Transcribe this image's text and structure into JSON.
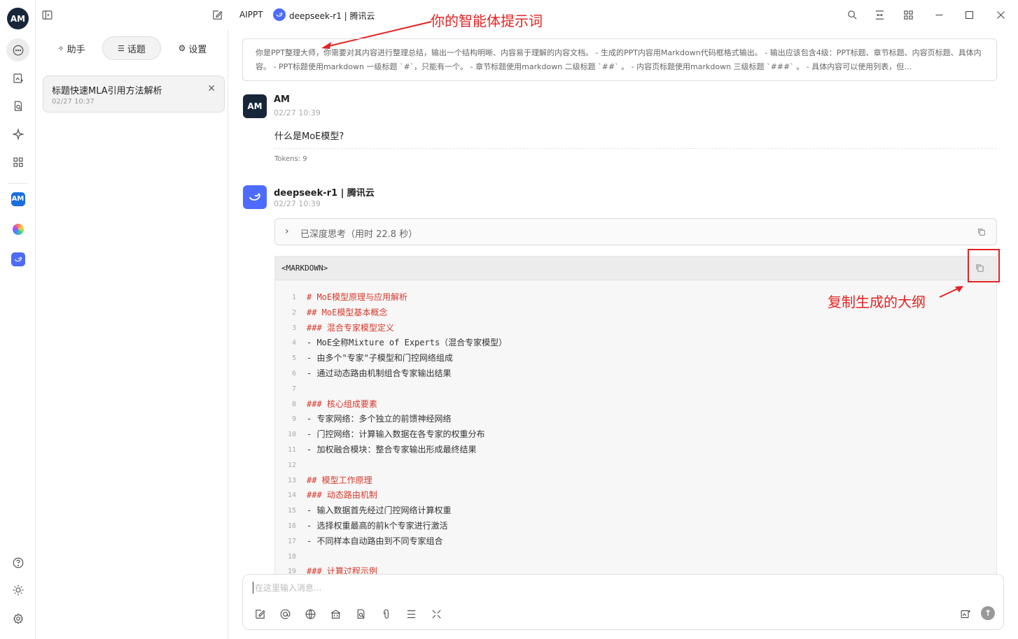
{
  "rail": {
    "logo": "AM",
    "avatar_a": "AM"
  },
  "topbar": {
    "app_name": "AIPPT",
    "model_label": "deepseek-r1 | 腾讯云"
  },
  "annotations": {
    "prompt_note": "你的智能体提示词",
    "copy_note": "复制生成的大纲"
  },
  "panel": {
    "tabs": [
      {
        "label": "助手"
      },
      {
        "label": "话题"
      },
      {
        "label": "设置"
      }
    ],
    "topic": {
      "title": "标题快速MLA引用方法解析",
      "time": "02/27 10:37",
      "close": "✕"
    }
  },
  "prompt_text": "你是PPT整理大师，你需要对其内容进行整理总结，输出一个结构明晰、内容易于理解的内容文档。 - 生成的PPT内容用Markdown代码框格式输出。 - 输出应该包含4级：PPT标题、章节标题、内容页标题、具体内容。 - PPT标题使用markdown 一级标题 `#`，只能有一个。 - 章节标题使用markdown 二级标题 `##` 。 - 内容页标题使用markdown 三级标题 `###` 。 - 具体内容可以使用列表，但…",
  "user_msg": {
    "name": "AM",
    "time": "02/27 10:39",
    "text": "什么是MoE模型?",
    "tokens": "Tokens: 9"
  },
  "bot_msg": {
    "name": "deepseek-r1 | 腾讯云",
    "time": "02/27 10:39",
    "think_label": "已深度思考（用时 22.8 秒）",
    "code_lang": "<MARKDOWN>",
    "code_lines": [
      {
        "n": "1",
        "t": "# MoE模型原理与应用解析",
        "h": true
      },
      {
        "n": "2",
        "t": "## MoE模型基本概念",
        "h": true
      },
      {
        "n": "3",
        "t": "### 混合专家模型定义",
        "h": true
      },
      {
        "n": "4",
        "t": "- MoE全称Mixture of Experts（混合专家模型）",
        "h": false
      },
      {
        "n": "5",
        "t": "- 由多个\"专家\"子模型和门控网络组成",
        "h": false
      },
      {
        "n": "6",
        "t": "- 通过动态路由机制组合专家输出结果",
        "h": false
      },
      {
        "n": "7",
        "t": "",
        "h": false
      },
      {
        "n": "8",
        "t": "### 核心组成要素",
        "h": true
      },
      {
        "n": "9",
        "t": "- 专家网络：多个独立的前馈神经网络",
        "h": false
      },
      {
        "n": "10",
        "t": "- 门控网络：计算输入数据在各专家的权重分布",
        "h": false
      },
      {
        "n": "11",
        "t": "- 加权融合模块：整合专家输出形成最终结果",
        "h": false
      },
      {
        "n": "12",
        "t": "",
        "h": false
      },
      {
        "n": "13",
        "t": "## 模型工作原理",
        "h": true
      },
      {
        "n": "14",
        "t": "### 动态路由机制",
        "h": true
      },
      {
        "n": "15",
        "t": "- 输入数据首先经过门控网络计算权重",
        "h": false
      },
      {
        "n": "16",
        "t": "- 选择权重最高的前k个专家进行激活",
        "h": false
      },
      {
        "n": "17",
        "t": "- 不同样本自动路由到不同专家组合",
        "h": false
      },
      {
        "n": "18",
        "t": "",
        "h": false
      },
      {
        "n": "19",
        "t": "### 计算过程示例",
        "h": true
      }
    ]
  },
  "input": {
    "placeholder": "在这里输入消息..."
  }
}
